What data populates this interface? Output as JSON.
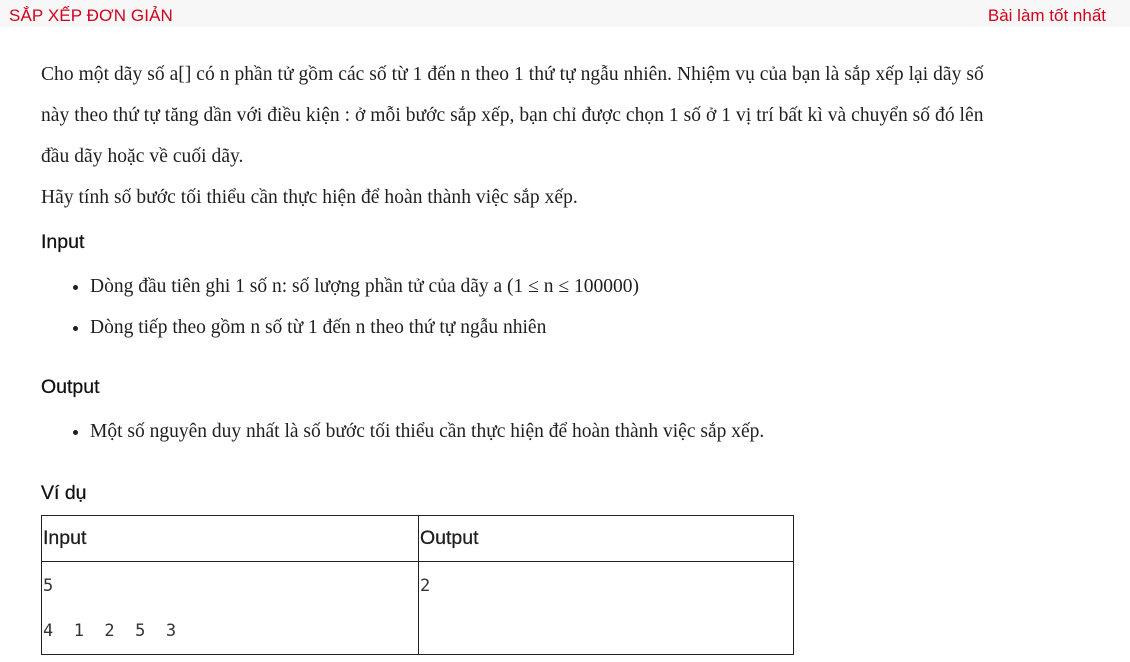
{
  "header": {
    "title": "SẮP XẾP ĐƠN GIẢN",
    "best_link": "Bài làm tốt nhất"
  },
  "description": {
    "lines": [
      "Cho một dãy số a[] có n phần tử gồm các số từ 1 đến n theo 1 thứ tự ngẫu nhiên. Nhiệm vụ của bạn là sắp xếp lại dãy số",
      "này theo thứ tự tăng dần với điều kiện : ở mỗi bước sắp xếp, bạn chỉ được chọn 1 số ở 1 vị trí bất kì và chuyển số đó lên",
      "đầu dãy hoặc về cuối dãy.",
      "Hãy tính số bước tối thiểu cần thực hiện để hoàn thành việc sắp xếp."
    ]
  },
  "input_section": {
    "heading": "Input",
    "items": [
      "Dòng đầu tiên ghi 1 số n: số lượng phần tử của dãy a (1 ≤ n ≤ 100000)",
      "Dòng tiếp theo gồm n số từ 1 đến n theo thứ tự ngẫu nhiên"
    ]
  },
  "output_section": {
    "heading": "Output",
    "items": [
      "Một số nguyên duy nhất là số bước tối thiểu cần thực hiện để hoàn thành việc sắp xếp."
    ]
  },
  "example": {
    "heading": "Ví dụ",
    "columns": [
      "Input",
      "Output"
    ],
    "input_lines": [
      "5",
      "4 1 2 5 3"
    ],
    "output_lines": [
      "2"
    ]
  },
  "colors": {
    "accent": "#d0021b",
    "topbar_bg": "#f7f7f7",
    "text": "#1f1f1f"
  }
}
